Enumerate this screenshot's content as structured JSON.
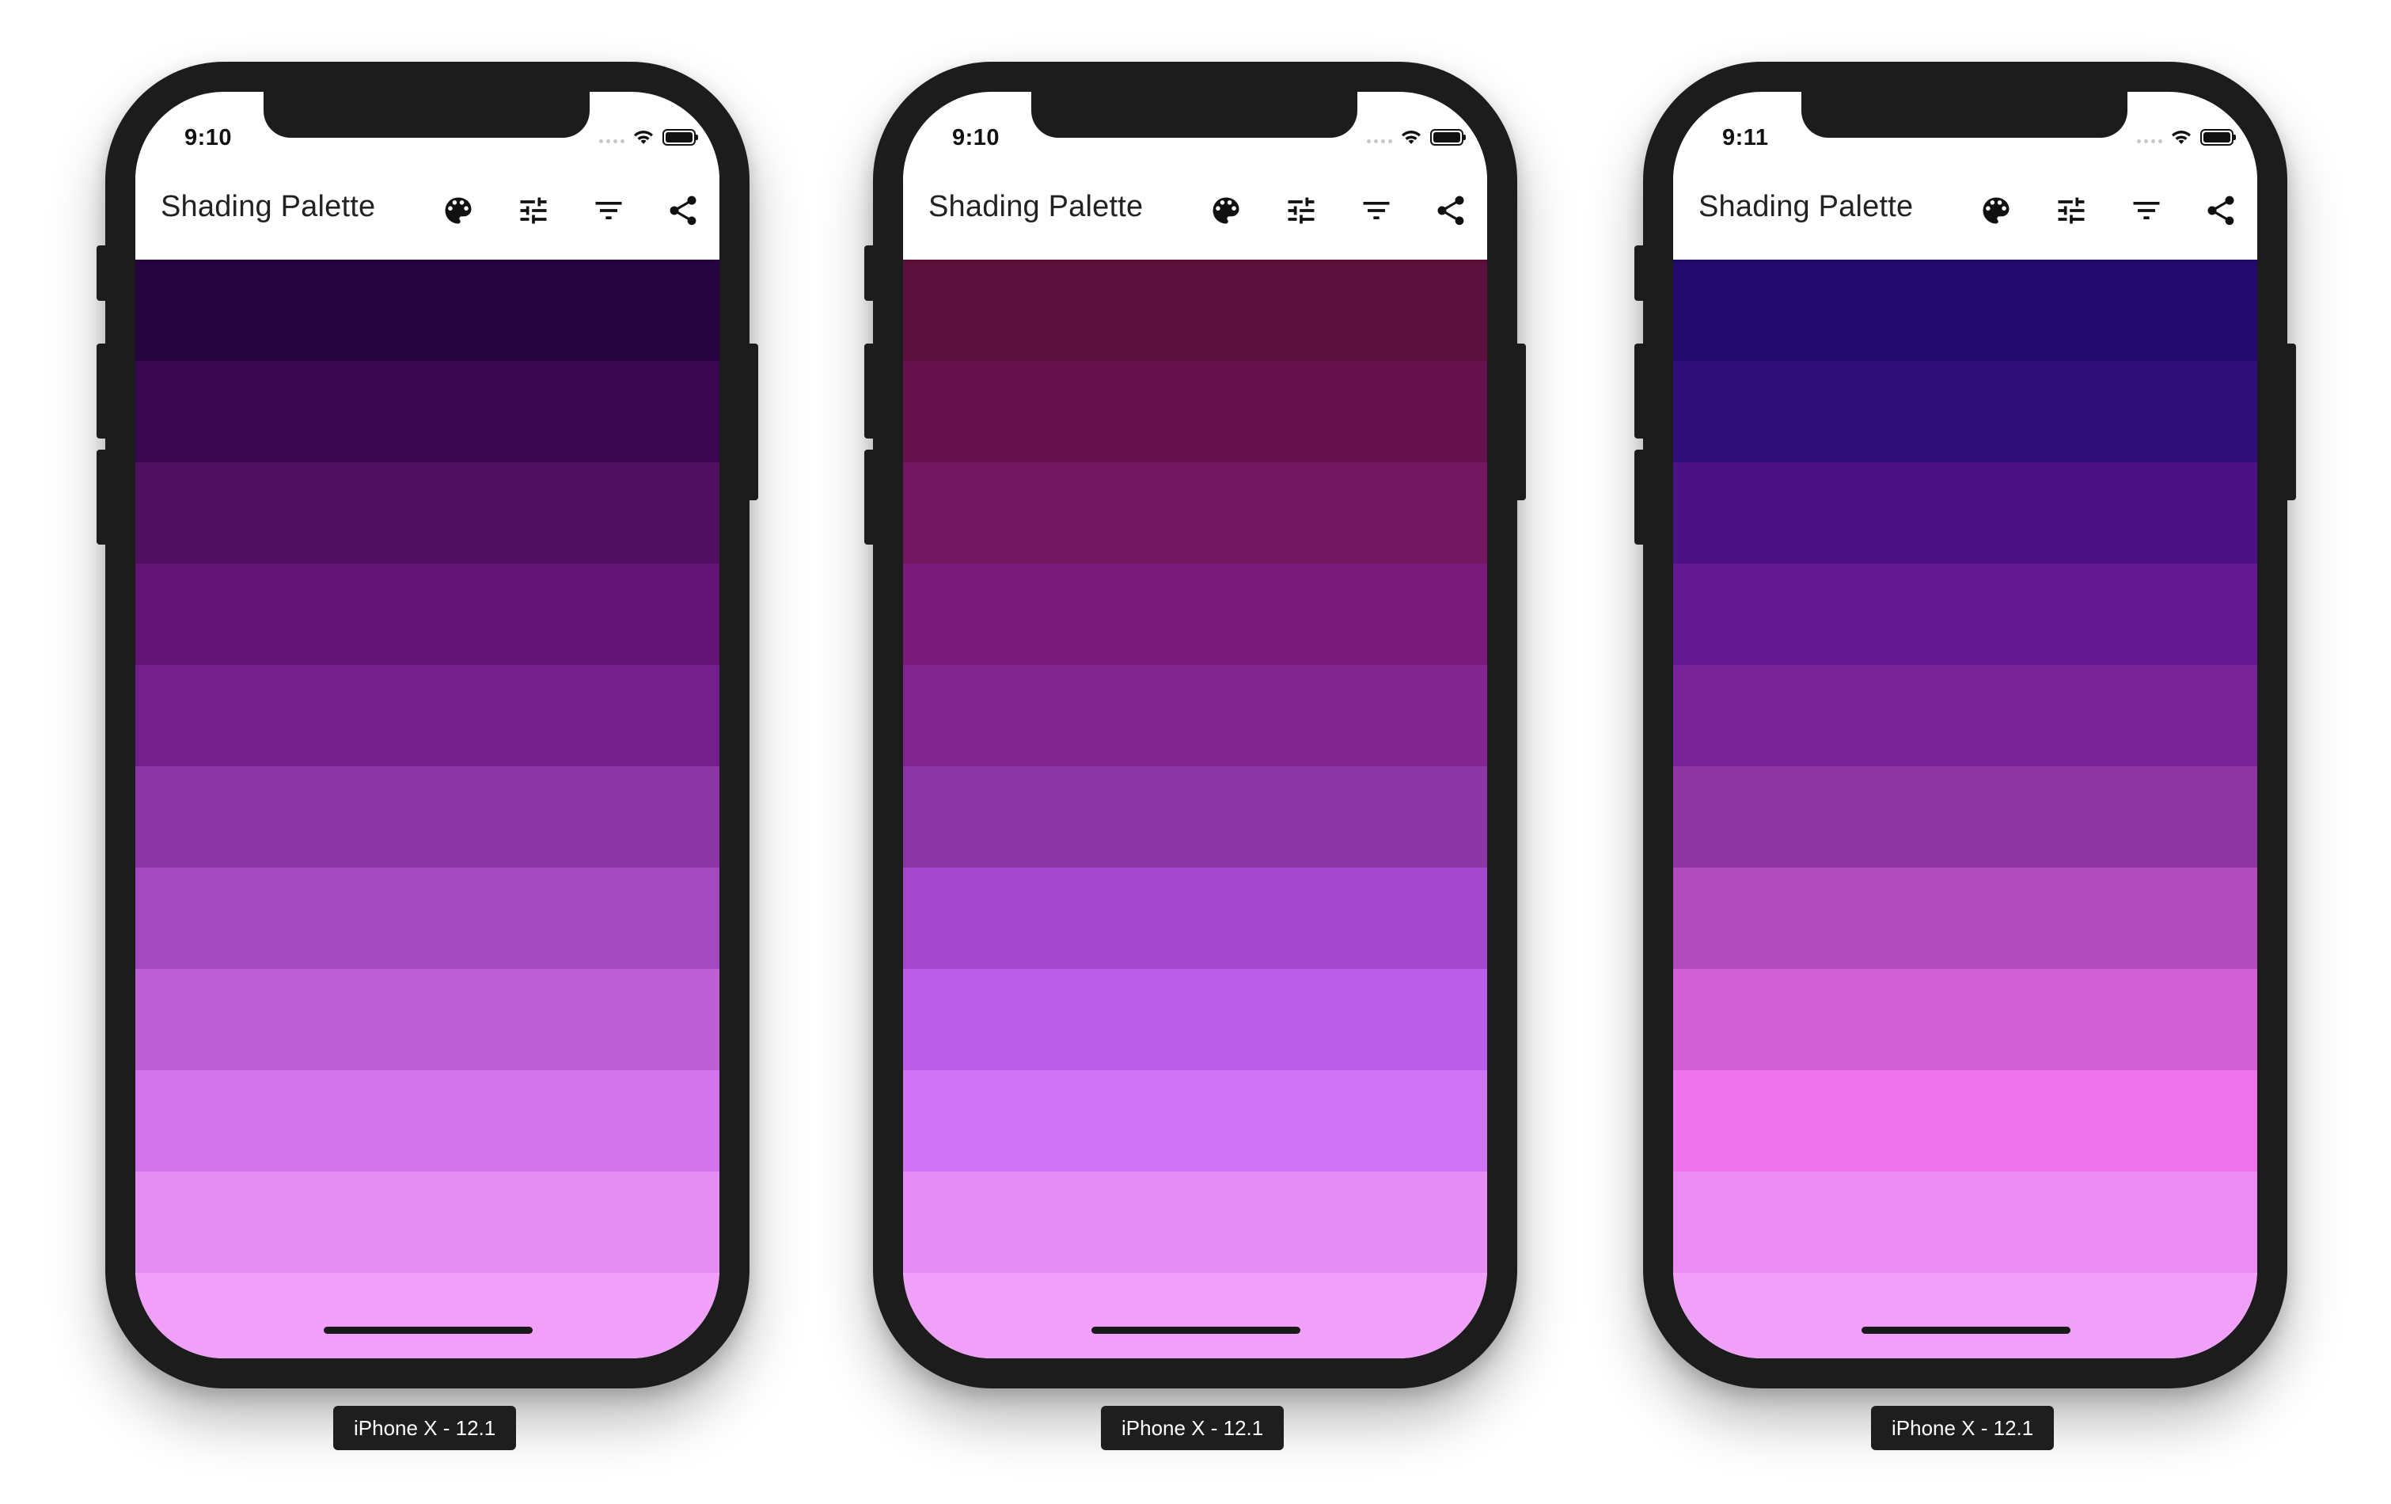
{
  "devices": [
    {
      "status_time": "9:10",
      "app_title": "Shading Palette",
      "label": "iPhone X - 12.1",
      "swatches": [
        "#26043f",
        "#38074f",
        "#4e0f60",
        "#631375",
        "#74208c",
        "#8c35a6",
        "#a449bf",
        "#bc5fd4",
        "#d274eb",
        "#e58cf3",
        "#f0a0f8"
      ]
    },
    {
      "status_time": "9:10",
      "app_title": "Shading Palette",
      "label": "iPhone X - 12.1",
      "swatches": [
        "#5c103c",
        "#66124d",
        "#72165f",
        "#7a1a79",
        "#832591",
        "#8c35a5",
        "#a449cf",
        "#bb5eea",
        "#d074f6",
        "#e48cf3",
        "#f0a0f8"
      ]
    },
    {
      "status_time": "9:11",
      "app_title": "Shading Palette",
      "label": "iPhone X - 12.1",
      "swatches": [
        "#210a6c",
        "#310f78",
        "#4a1283",
        "#63198f",
        "#782397",
        "#8f35a4",
        "#b24bbc",
        "#d060d3",
        "#ee74ec",
        "#ec8cf3",
        "#f0a0f8"
      ]
    }
  ],
  "icons": {
    "palette": "palette-icon",
    "tune": "tune-icon",
    "filter": "filter-list-icon",
    "share": "share-icon",
    "wifi": "wifi-icon",
    "battery": "battery-icon",
    "cellular": "cellular-signal-icon"
  }
}
